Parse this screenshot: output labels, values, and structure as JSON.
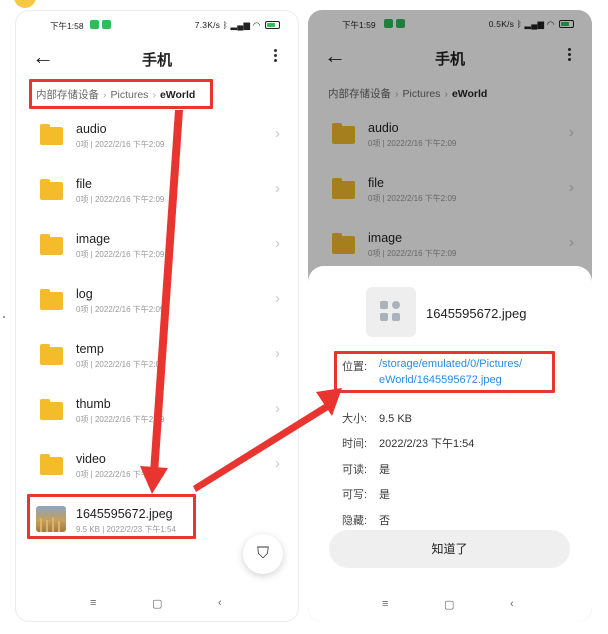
{
  "left": {
    "status": {
      "time": "下午1:58",
      "net": "7.3K/s",
      "battery": ""
    },
    "title": "手机",
    "breadcrumb": [
      "内部存储设备",
      "Pictures",
      "eWorld"
    ],
    "folders": [
      {
        "name": "audio",
        "meta": "0项 | 2022/2/16 下午2:09"
      },
      {
        "name": "file",
        "meta": "0项 | 2022/2/16 下午2:09"
      },
      {
        "name": "image",
        "meta": "0项 | 2022/2/16 下午2:09"
      },
      {
        "name": "log",
        "meta": "0项 | 2022/2/16 下午2:09"
      },
      {
        "name": "temp",
        "meta": "0项 | 2022/2/16 下午2:09"
      },
      {
        "name": "thumb",
        "meta": "0项 | 2022/2/16 下午2:09"
      },
      {
        "name": "video",
        "meta": "0项 | 2022/2/16 下午2:09"
      }
    ],
    "file": {
      "name": "1645595672.jpeg",
      "meta": "9.5 KB | 2022/2/23 下午1:54"
    }
  },
  "right": {
    "status": {
      "time": "下午1:59",
      "net": "0.5K/s"
    },
    "title": "手机",
    "breadcrumb": [
      "内部存储设备",
      "Pictures",
      "eWorld"
    ],
    "folders": [
      {
        "name": "audio",
        "meta": "0项 | 2022/2/16 下午2:09"
      },
      {
        "name": "file",
        "meta": "0项 | 2022/2/16 下午2:09"
      },
      {
        "name": "image",
        "meta": "0项 | 2022/2/16 下午2:09"
      }
    ],
    "sheet": {
      "file_name": "1645595672.jpeg",
      "location_label": "位置:",
      "location_line1": "/storage/emulated/0/Pictures/",
      "location_line2": "eWorld/1645595672.jpeg",
      "size_label": "大小:",
      "size_value": "9.5 KB",
      "time_label": "时间:",
      "time_value": "2022/2/23 下午1:54",
      "readable_label": "可读:",
      "readable_value": "是",
      "writable_label": "可写:",
      "writable_value": "是",
      "hidden_label": "隐藏:",
      "hidden_value": "否",
      "ok_label": "知道了"
    }
  },
  "icons": {
    "back": "←",
    "chevron": "›",
    "filter": "⛉",
    "nav_menu": "≡",
    "nav_home": "▢",
    "nav_back": "‹"
  },
  "colors": {
    "highlight": "#e83530",
    "folder": "#f4bb2b",
    "link": "#2b8ae0"
  }
}
